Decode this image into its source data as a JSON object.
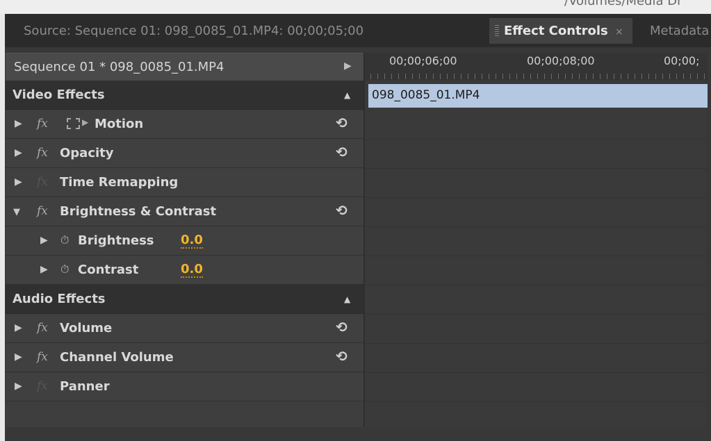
{
  "window": {
    "path_fragment": "/Volumes/Media Dr"
  },
  "tabs": {
    "source": "Source: Sequence 01: 098_0085_01.MP4: 00;00;05;00",
    "effect_controls": "Effect Controls",
    "effect_controls_close": "×",
    "metadata": "Metadata"
  },
  "header": {
    "sequence_label": "Sequence 01 * 098_0085_01.MP4"
  },
  "ruler": {
    "timecodes": [
      "00;00;06;00",
      "00;00;08;00",
      "00;00;"
    ]
  },
  "clip": {
    "label": "098_0085_01.MP4",
    "color": "#b5c8e1"
  },
  "sections": {
    "video": "Video Effects",
    "audio": "Audio Effects"
  },
  "video_effects": {
    "motion": "Motion",
    "opacity": "Opacity",
    "time_remapping": "Time Remapping",
    "brightness_contrast": "Brightness & Contrast",
    "brightness": {
      "label": "Brightness",
      "value": "0.0"
    },
    "contrast": {
      "label": "Contrast",
      "value": "0.0"
    }
  },
  "audio_effects": {
    "volume": "Volume",
    "channel_volume": "Channel Volume",
    "panner": "Panner"
  },
  "icons": {
    "fx": "fx",
    "reset": "⟲",
    "triangle_right": "▶",
    "triangle_down": "▼",
    "triangle_up": "▲",
    "stopwatch": "⏱"
  },
  "colors": {
    "value_accent": "#f0b529",
    "clip": "#b5c8e1"
  }
}
